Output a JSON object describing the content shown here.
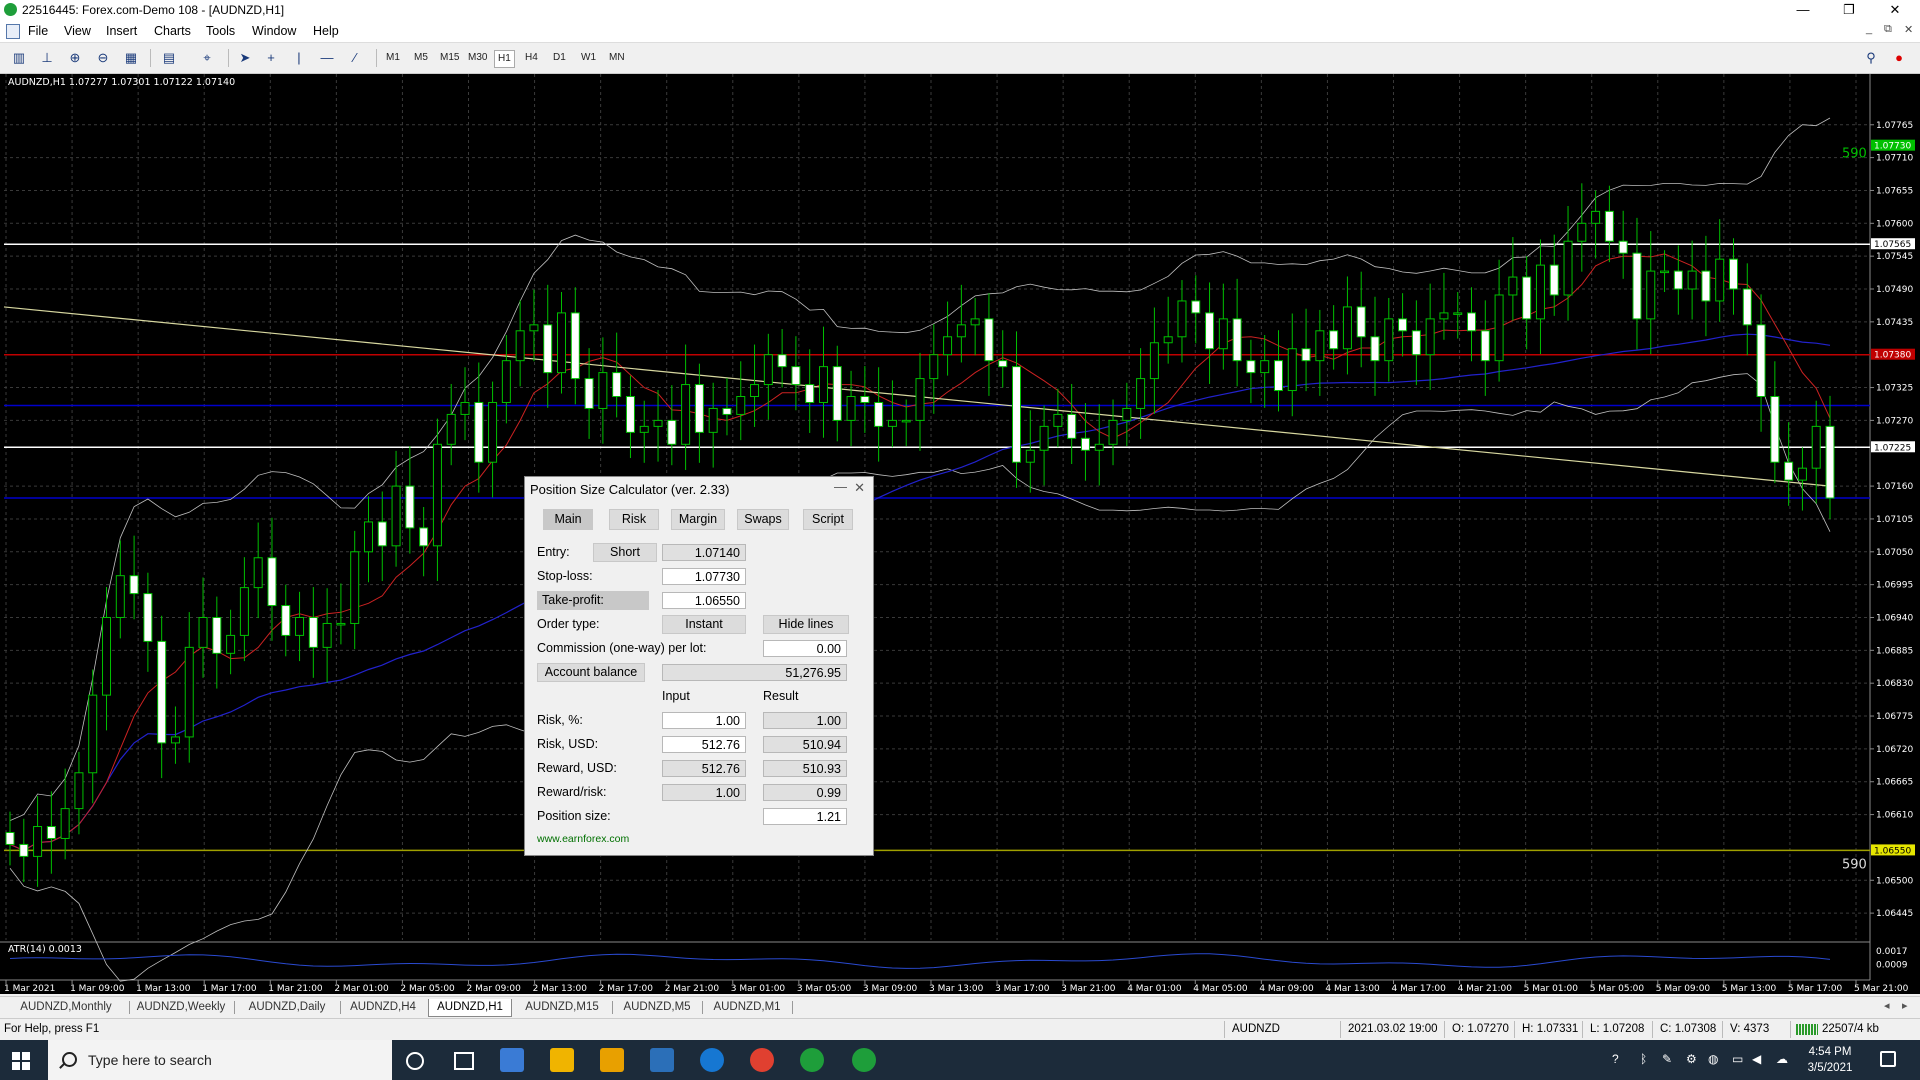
{
  "window": {
    "title": "22516445: Forex.com-Demo 108 - [AUDNZD,H1]",
    "controls": {
      "minimize": "—",
      "maximize": "❐",
      "close": "✕"
    },
    "mdi_controls": {
      "minimize": "_",
      "restore": "⧉",
      "close": "✕"
    }
  },
  "menu": {
    "items": [
      "File",
      "View",
      "Insert",
      "Charts",
      "Tools",
      "Window",
      "Help"
    ]
  },
  "toolbar": {
    "timeframes": [
      "M1",
      "M5",
      "M15",
      "M30",
      "H1",
      "H4",
      "D1",
      "W1",
      "MN"
    ],
    "active_timeframe": "H1",
    "icons": [
      "new-chart",
      "candles-chart",
      "zoom-in",
      "zoom-out",
      "tile-windows",
      "template",
      "crosshair",
      "cursor",
      "crosshair-line",
      "vertical-line",
      "horizontal-line",
      "trendline"
    ]
  },
  "chart_data": {
    "type": "candlestick",
    "symbol_info": "AUDNZD,H1  1.07277 1.07301 1.07122 1.07140",
    "price_axis": {
      "min": 1.064,
      "max": 1.0785,
      "ticks": [
        "1.07765",
        "1.07710",
        "1.07655",
        "1.07600",
        "1.07545",
        "1.07490",
        "1.07435",
        "1.07325",
        "1.07270",
        "1.07160",
        "1.07105",
        "1.07050",
        "1.06995",
        "1.06940",
        "1.06885",
        "1.06830",
        "1.06775",
        "1.06720",
        "1.06665",
        "1.06610",
        "1.06500",
        "1.06445"
      ],
      "tick_values": [
        1.07765,
        1.0771,
        1.07655,
        1.076,
        1.07545,
        1.0749,
        1.07435,
        1.07325,
        1.0727,
        1.0716,
        1.07105,
        1.0705,
        1.06995,
        1.0694,
        1.06885,
        1.0683,
        1.06775,
        1.0672,
        1.06665,
        1.0661,
        1.065,
        1.06445
      ]
    },
    "price_labels": [
      {
        "text": "1.07730",
        "value": 1.0773,
        "color": "#00c000"
      },
      {
        "text": "1.07565",
        "value": 1.07565,
        "color": "#ffffff"
      },
      {
        "text": "1.07380",
        "value": 1.0738,
        "color": "#c00000"
      },
      {
        "text": "1.07225",
        "value": 1.07225,
        "color": "#ffffff"
      },
      {
        "text": "1.06550",
        "value": 1.0655,
        "color": "#e6e600"
      }
    ],
    "horizontal_lines": [
      {
        "value": 1.07565,
        "color": "#ffffff"
      },
      {
        "value": 1.07225,
        "color": "#ffffff"
      },
      {
        "value": 1.0738,
        "color": "#c00000"
      },
      {
        "value": 1.07295,
        "color": "#0000cc"
      },
      {
        "value": 1.0714,
        "color": "#0000cc"
      },
      {
        "value": 1.0655,
        "color": "#a0a000"
      }
    ],
    "level_labels": [
      {
        "text": "590",
        "value": 1.0771,
        "color": "#00c000"
      },
      {
        "text": "590",
        "value": 1.0652,
        "color": "#dddddd"
      }
    ],
    "time_labels": [
      "1 Mar 2021",
      "1 Mar 09:00",
      "1 Mar 13:00",
      "1 Mar 17:00",
      "1 Mar 21:00",
      "2 Mar 01:00",
      "2 Mar 05:00",
      "2 Mar 09:00",
      "2 Mar 13:00",
      "2 Mar 17:00",
      "2 Mar 21:00",
      "3 Mar 01:00",
      "3 Mar 05:00",
      "3 Mar 09:00",
      "3 Mar 13:00",
      "3 Mar 17:00",
      "3 Mar 21:00",
      "4 Mar 01:00",
      "4 Mar 05:00",
      "4 Mar 09:00",
      "4 Mar 13:00",
      "4 Mar 17:00",
      "4 Mar 21:00",
      "5 Mar 01:00",
      "5 Mar 05:00",
      "5 Mar 09:00",
      "5 Mar 13:00",
      "5 Mar 17:00",
      "5 Mar 21:00"
    ],
    "close": [
      1.0656,
      1.0654,
      1.0659,
      1.0657,
      1.0662,
      1.0668,
      1.0681,
      1.0694,
      1.0701,
      1.0698,
      1.069,
      1.0673,
      1.0674,
      1.0689,
      1.0694,
      1.0688,
      1.0691,
      1.0699,
      1.0704,
      1.0696,
      1.0691,
      1.0694,
      1.0689,
      1.0693,
      1.0693,
      1.0705,
      1.071,
      1.0706,
      1.0716,
      1.0709,
      1.0706,
      1.0723,
      1.0728,
      1.073,
      1.072,
      1.073,
      1.0737,
      1.0742,
      1.0743,
      1.0735,
      1.0745,
      1.0734,
      1.0729,
      1.0735,
      1.0731,
      1.0725,
      1.0726,
      1.0727,
      1.0723,
      1.0733,
      1.0725,
      1.0729,
      1.0728,
      1.0731,
      1.0733,
      1.0738,
      1.0736,
      1.0733,
      1.073,
      1.0736,
      1.0727,
      1.0731,
      1.073,
      1.0726,
      1.0727,
      1.0727,
      1.0734,
      1.0738,
      1.0741,
      1.0743,
      1.0744,
      1.0737,
      1.0736,
      1.072,
      1.0722,
      1.0726,
      1.0728,
      1.0724,
      1.0722,
      1.0723,
      1.0727,
      1.0729,
      1.0734,
      1.074,
      1.0741,
      1.0747,
      1.0745,
      1.0739,
      1.0744,
      1.0737,
      1.0735,
      1.0737,
      1.0732,
      1.0739,
      1.0737,
      1.0742,
      1.0739,
      1.0746,
      1.0741,
      1.0737,
      1.0744,
      1.0742,
      1.0738,
      1.0744,
      1.0745,
      1.0745,
      1.0742,
      1.0737,
      1.0748,
      1.0751,
      1.0744,
      1.0753,
      1.0748,
      1.0757,
      1.076,
      1.0762,
      1.0757,
      1.0755,
      1.0744,
      1.0752,
      1.0752,
      1.0749,
      1.0752,
      1.0747,
      1.0754,
      1.0749,
      1.0743,
      1.0731,
      1.072,
      1.0717,
      1.0719,
      1.0726,
      1.0714
    ],
    "indicators": [
      {
        "kind": "bollinger-bands",
        "color": "#c0c0c0"
      },
      {
        "kind": "moving-average",
        "color": "#cc2222"
      },
      {
        "kind": "moving-average",
        "color": "#2222cc"
      },
      {
        "kind": "moving-average",
        "color": "#d8d8a0"
      }
    ],
    "atr": {
      "label": "ATR(14) 0.0013",
      "ticks": [
        "0.0017",
        "0.0009"
      ],
      "tick_values": [
        0.0017,
        0.0009
      ],
      "min": 0.0002,
      "max": 0.002
    }
  },
  "calculator": {
    "title": "Position Size Calculator (ver. 2.33)",
    "min_icon": "—",
    "close_icon": "✕",
    "tabs": [
      "Main",
      "Risk",
      "Margin",
      "Swaps",
      "Script"
    ],
    "entry": {
      "label": "Entry:",
      "type_button": "Short",
      "value": "1.07140"
    },
    "stop_loss": {
      "label": "Stop-loss:",
      "value": "1.07730"
    },
    "take_profit": {
      "label": "Take-profit:",
      "value": "1.06550"
    },
    "order_type": {
      "label": "Order type:",
      "value": "Instant",
      "hide_lines": "Hide lines"
    },
    "commission": {
      "label": "Commission (one-way) per lot:",
      "value": "0.00"
    },
    "account_balance": {
      "label": "Account balance",
      "value": "51,276.95"
    },
    "col_input": "Input",
    "col_result": "Result",
    "risk_pct": {
      "label": "Risk, %:",
      "input": "1.00",
      "result": "1.00"
    },
    "risk_usd": {
      "label": "Risk, USD:",
      "input": "512.76",
      "result": "510.94"
    },
    "reward_usd": {
      "label": "Reward, USD:",
      "input": "512.76",
      "result": "510.93"
    },
    "reward_risk": {
      "label": "Reward/risk:",
      "input": "1.00",
      "result": "0.99"
    },
    "position_size": {
      "label": "Position size:",
      "result": "1.21"
    },
    "link": "www.earnforex.com"
  },
  "chart_tabs": {
    "items": [
      "AUDNZD,Monthly",
      "AUDNZD,Weekly",
      "AUDNZD,Daily",
      "AUDNZD,H4",
      "AUDNZD,H1",
      "AUDNZD,M15",
      "AUDNZD,M5",
      "AUDNZD,M1"
    ],
    "active": "AUDNZD,H1",
    "nav": [
      "◂",
      "▸"
    ]
  },
  "status": {
    "help": "For Help, press F1",
    "symbol": "AUDNZD",
    "datetime": "2021.03.02 19:00",
    "open": "O: 1.07270",
    "high": "H: 1.07331",
    "low": "L: 1.07208",
    "close": "C: 1.07308",
    "volume": "V: 4373",
    "traffic": "22507/4 kb"
  },
  "taskbar": {
    "search_placeholder": "Type here to search",
    "time": "4:54 PM",
    "date": "3/5/2021",
    "app_colors": [
      "#3a7bd5",
      "#f0b400",
      "#e8a000",
      "#2b6fb8",
      "#1677d2",
      "#e04030",
      "#1e9e3a",
      "#1e9e3a"
    ]
  }
}
